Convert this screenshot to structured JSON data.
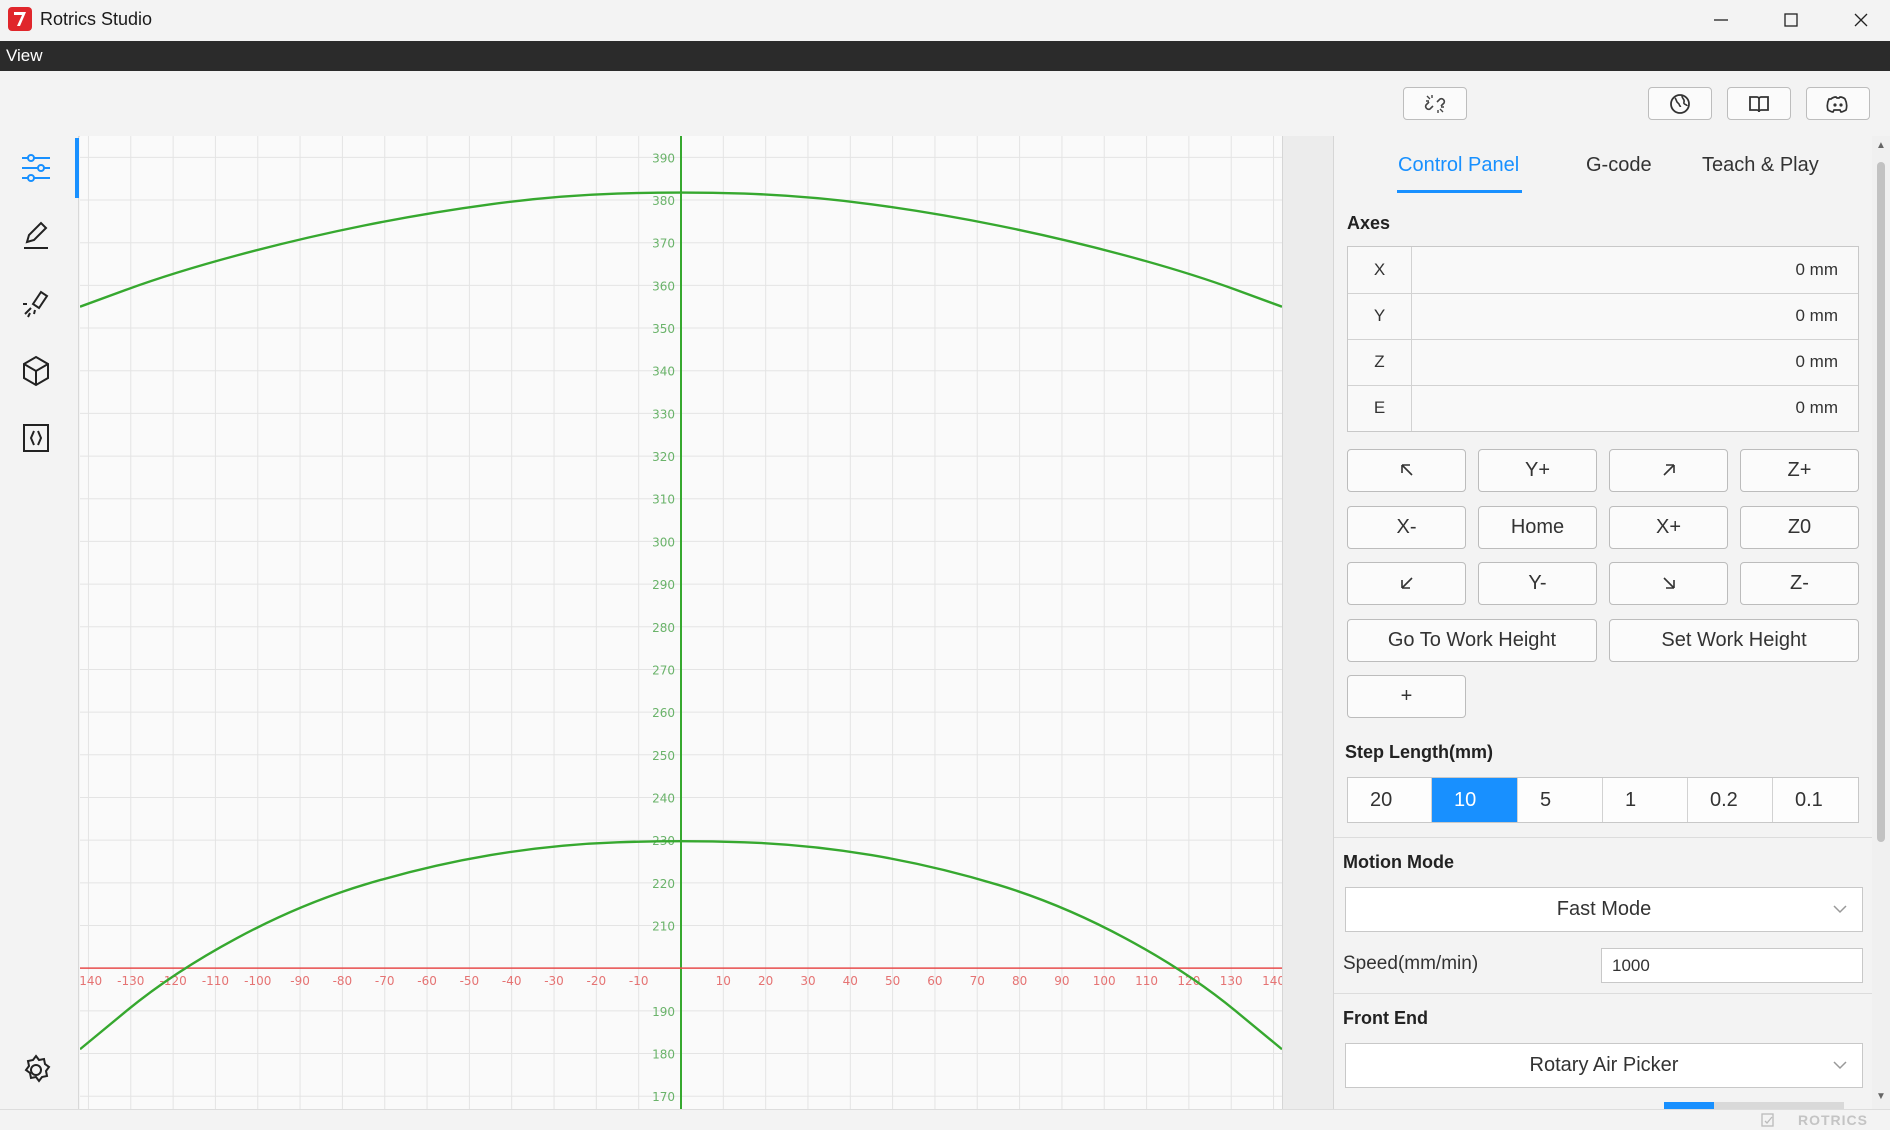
{
  "window": {
    "title": "Rotrics Studio",
    "controls": {
      "minimize": "minimize-icon",
      "maximize": "maximize-icon",
      "close": "close-icon"
    }
  },
  "menu": {
    "items": [
      "View"
    ]
  },
  "toolbar": {
    "buttons": [
      {
        "name": "disconnect-icon"
      },
      {
        "name": "language-icon"
      },
      {
        "name": "guide-book-icon"
      },
      {
        "name": "discord-icon"
      }
    ]
  },
  "sidebar": {
    "items": [
      {
        "name": "control-panel-icon",
        "active": true
      },
      {
        "name": "write-draw-icon"
      },
      {
        "name": "laser-icon"
      },
      {
        "name": "3d-print-icon"
      },
      {
        "name": "code-icon"
      }
    ],
    "settings": "settings-icon"
  },
  "colors": {
    "accent": "#1890ff",
    "grid_line": "#e4e4e4",
    "green": "#36a82f",
    "red": "#e84c4c",
    "green_label": "#6ab36a",
    "red_label": "#e57373"
  },
  "chart_data": {
    "type": "line",
    "x_ticks": [
      -140,
      -130,
      -120,
      -110,
      -100,
      -90,
      -80,
      -70,
      -60,
      -50,
      -40,
      -30,
      -20,
      -10,
      10,
      20,
      30,
      40,
      50,
      60,
      70,
      80,
      90,
      100,
      110,
      120,
      130,
      140
    ],
    "y_ticks": [
      390,
      380,
      370,
      360,
      350,
      340,
      330,
      320,
      310,
      300,
      290,
      280,
      270,
      260,
      250,
      240,
      230,
      220,
      210,
      190,
      180,
      170
    ],
    "xlim": [
      -142,
      142
    ],
    "ylim": [
      167,
      395
    ],
    "series": [
      {
        "points": [
          [
            -142,
            355
          ],
          [
            -120,
            363
          ],
          [
            -90,
            371
          ],
          [
            -60,
            377
          ],
          [
            -30,
            381
          ],
          [
            0,
            382
          ],
          [
            30,
            381
          ],
          [
            60,
            377
          ],
          [
            90,
            371
          ],
          [
            120,
            363
          ],
          [
            142,
            355
          ]
        ]
      },
      {
        "points": [
          [
            -142,
            181
          ],
          [
            -120,
            199
          ],
          [
            -90,
            215
          ],
          [
            -60,
            224
          ],
          [
            -30,
            229
          ],
          [
            0,
            230
          ],
          [
            30,
            229
          ],
          [
            60,
            224
          ],
          [
            90,
            215
          ],
          [
            120,
            199
          ],
          [
            142,
            181
          ]
        ]
      }
    ],
    "grid": true
  },
  "panel": {
    "tabs": [
      "Control Panel",
      "G-code",
      "Teach & Play"
    ],
    "active_tab": "Control Panel",
    "axes": {
      "title": "Axes",
      "rows": [
        {
          "name": "X",
          "value": "0 mm"
        },
        {
          "name": "Y",
          "value": "0 mm"
        },
        {
          "name": "Z",
          "value": "0 mm"
        },
        {
          "name": "E",
          "value": "0 mm"
        }
      ]
    },
    "jog": {
      "row1": [
        "arrow-up-left-icon",
        "Y+",
        "arrow-up-right-icon",
        "Z+"
      ],
      "row2": [
        "X-",
        "Home",
        "X+",
        "Z0"
      ],
      "row3": [
        "arrow-down-left-icon",
        "Y-",
        "arrow-down-right-icon",
        "Z-"
      ],
      "go_to_work_height": "Go To Work Height",
      "set_work_height": "Set Work Height",
      "add": "+"
    },
    "step": {
      "title": "Step Length(mm)",
      "options": [
        "20",
        "10",
        "5",
        "1",
        "0.2",
        "0.1"
      ],
      "selected": "10"
    },
    "motion": {
      "title": "Motion Mode",
      "mode": "Fast Mode",
      "speed_label": "Speed(mm/min)",
      "speed_value": "1000"
    },
    "front_end": {
      "title": "Front End",
      "value": "Rotary Air Picker"
    }
  },
  "status": {
    "brand": "ROTRICS"
  }
}
